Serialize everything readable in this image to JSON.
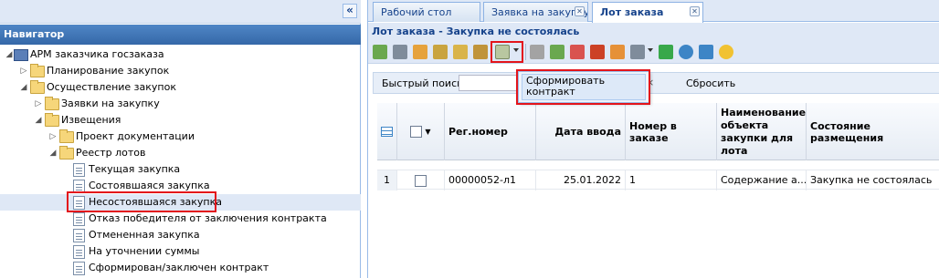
{
  "navigator": {
    "title": "Навигатор",
    "collapse_glyph": "«",
    "tree": [
      {
        "label": "АРМ заказчика госзаказа",
        "icon": "book-icon",
        "expanded": true
      },
      {
        "label": "Планирование закупок",
        "icon": "folder-icon",
        "expanded": false
      },
      {
        "label": "Осуществление закупок",
        "icon": "folder-icon",
        "expanded": true
      },
      {
        "label": "Заявки на закупку",
        "icon": "folder-icon",
        "expanded": false
      },
      {
        "label": "Извещения",
        "icon": "folder-icon",
        "expanded": true
      },
      {
        "label": "Проект документации",
        "icon": "folder-icon",
        "expanded": false
      },
      {
        "label": "Реестр лотов",
        "icon": "folder-icon",
        "expanded": true
      },
      {
        "label": "Текущая закупка",
        "icon": "document-icon"
      },
      {
        "label": "Состоявшаяся закупка",
        "icon": "document-icon"
      },
      {
        "label": "Несостоявшаяся закупка",
        "icon": "document-icon",
        "selected": true
      },
      {
        "label": "Отказ победителя от заключения контракта",
        "icon": "document-icon"
      },
      {
        "label": "Отмененная закупка",
        "icon": "document-icon"
      },
      {
        "label": "На уточнении суммы",
        "icon": "document-icon"
      },
      {
        "label": "Сформирован/заключен контракт",
        "icon": "document-icon"
      }
    ]
  },
  "tabs": [
    {
      "label": "Рабочий стол",
      "active": false
    },
    {
      "label": "Заявка на закупку",
      "active": false
    },
    {
      "label": "Лот заказа",
      "active": true
    }
  ],
  "panel_title": "Лот заказа - Закупка не состоялась",
  "toolbar_icons": [
    "add-icon",
    "print-icon",
    "copy-icon",
    "export-icon",
    "upload-icon",
    "import-icon",
    "edit-document-icon",
    "attach-icon",
    "download-icon",
    "delete-icon",
    "sort-icon",
    "filter-icon",
    "settings-icon",
    "refresh-icon",
    "info-icon",
    "navigate-icon",
    "help-icon"
  ],
  "search": {
    "label": "Быстрый поиск",
    "value": "",
    "reset_label": "Сбросить",
    "clear_glyph": "×"
  },
  "popup": {
    "item_label": "Сформировать контракт"
  },
  "grid": {
    "columns": [
      "Рег.номер",
      "Дата ввода",
      "Номер в заказе",
      "Наименование объекта закупки для лота",
      "Состояние размещения"
    ],
    "rows": [
      {
        "row_num": "1",
        "reg_number": "00000052-л1",
        "date": "25.01.2022",
        "order_number": "1",
        "name": "Содержание а...",
        "status": "Закупка не состоялась"
      }
    ]
  },
  "colors": {
    "highlight": "#e3141b",
    "header_blue": "#3568a8",
    "panel_bg": "#dfe8f6"
  }
}
